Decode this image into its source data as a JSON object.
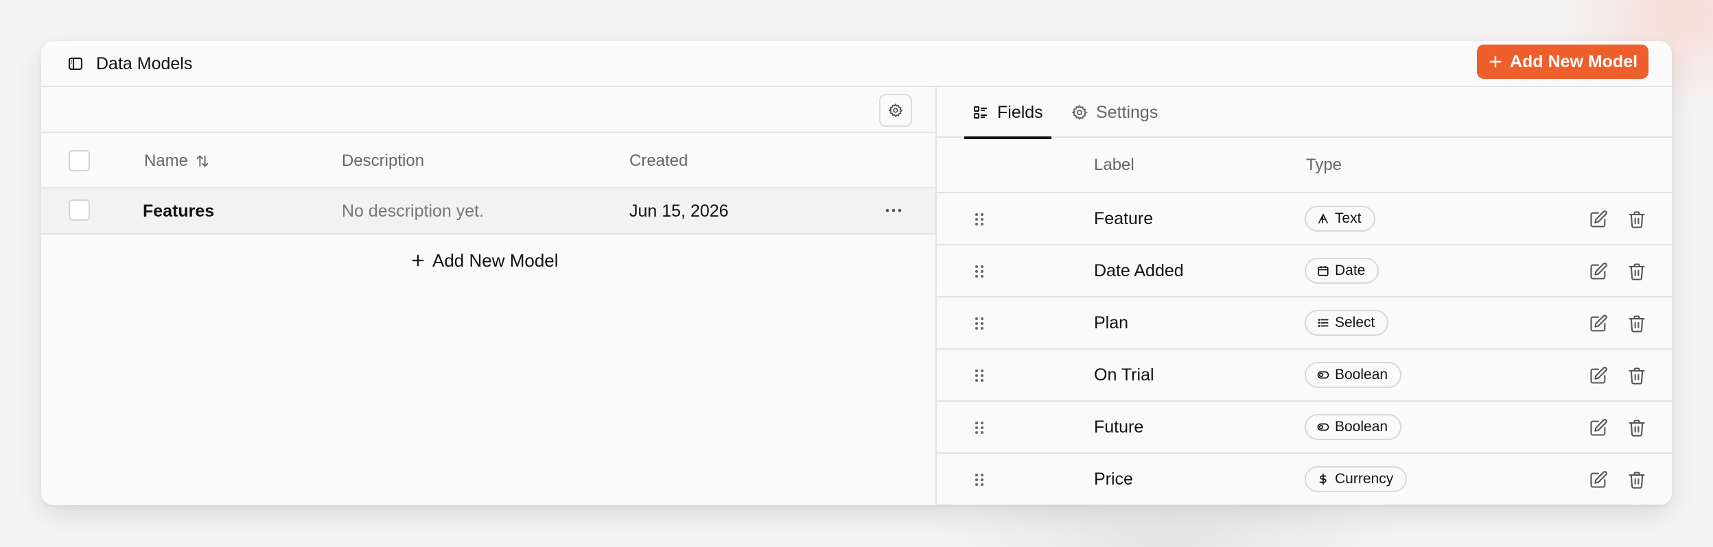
{
  "header": {
    "title": "Data Models",
    "add_button_label": "Add New Model"
  },
  "models_table": {
    "columns": {
      "name": "Name",
      "description": "Description",
      "created": "Created"
    },
    "rows": [
      {
        "name": "Features",
        "description": "No description yet.",
        "created": "Jun 15, 2026"
      }
    ],
    "add_link_label": "Add New Model"
  },
  "tabs": [
    {
      "label": "Fields",
      "icon": "list-icon",
      "active": true
    },
    {
      "label": "Settings",
      "icon": "gear-icon",
      "active": false
    }
  ],
  "fields_table": {
    "columns": {
      "label": "Label",
      "type": "Type"
    },
    "rows": [
      {
        "label": "Feature",
        "type": "Text",
        "type_icon": "text-icon"
      },
      {
        "label": "Date Added",
        "type": "Date",
        "type_icon": "calendar-icon"
      },
      {
        "label": "Plan",
        "type": "Select",
        "type_icon": "list-icon"
      },
      {
        "label": "On Trial",
        "type": "Boolean",
        "type_icon": "toggle-icon"
      },
      {
        "label": "Future",
        "type": "Boolean",
        "type_icon": "toggle-icon"
      },
      {
        "label": "Price",
        "type": "Currency",
        "type_icon": "dollar-icon"
      }
    ]
  },
  "colors": {
    "accent": "#ee5f2b",
    "border": "#e2e2e2",
    "muted_text": "#666666"
  }
}
